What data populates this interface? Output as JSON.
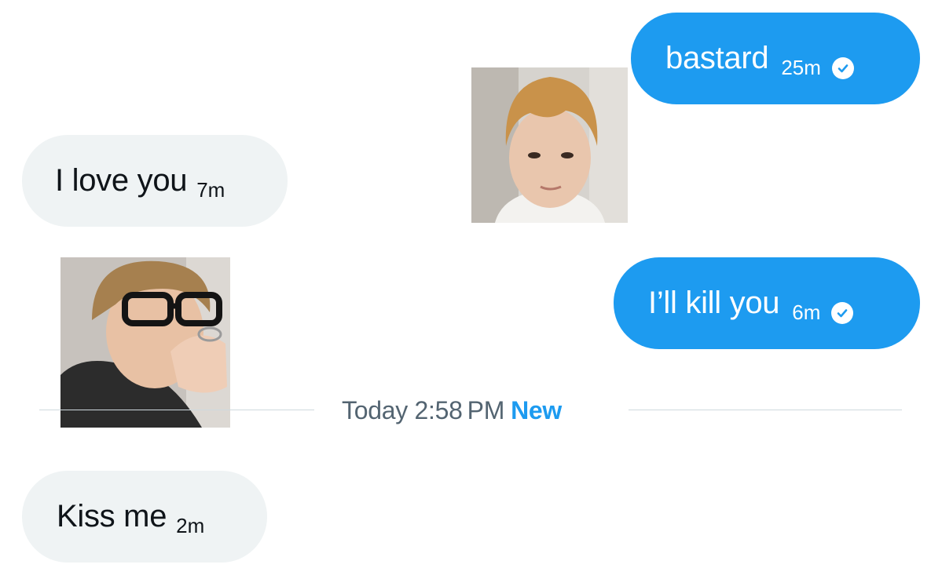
{
  "conversation": {
    "messages": [
      {
        "direction": "outgoing",
        "text": "bastard",
        "time": "25m",
        "status_icon": "check-circle-icon"
      },
      {
        "direction": "incoming",
        "text": "I love you",
        "time": "7m"
      },
      {
        "direction": "outgoing",
        "text": "I’ll kill you",
        "time": "6m",
        "status_icon": "check-circle-icon"
      },
      {
        "direction": "incoming",
        "text": "Kiss me",
        "time": "2m"
      }
    ],
    "images": [
      {
        "description": "selfie-photo",
        "position": "right"
      },
      {
        "description": "glasses-photo",
        "position": "left"
      }
    ],
    "divider": {
      "date_text": "Today 2:58 PM",
      "new_label": "New"
    }
  },
  "colors": {
    "accent": "#1d9bf0",
    "incoming_bubble": "#eff3f4",
    "text_primary": "#0f1419",
    "text_secondary": "#536471",
    "divider": "#cfd9de"
  }
}
